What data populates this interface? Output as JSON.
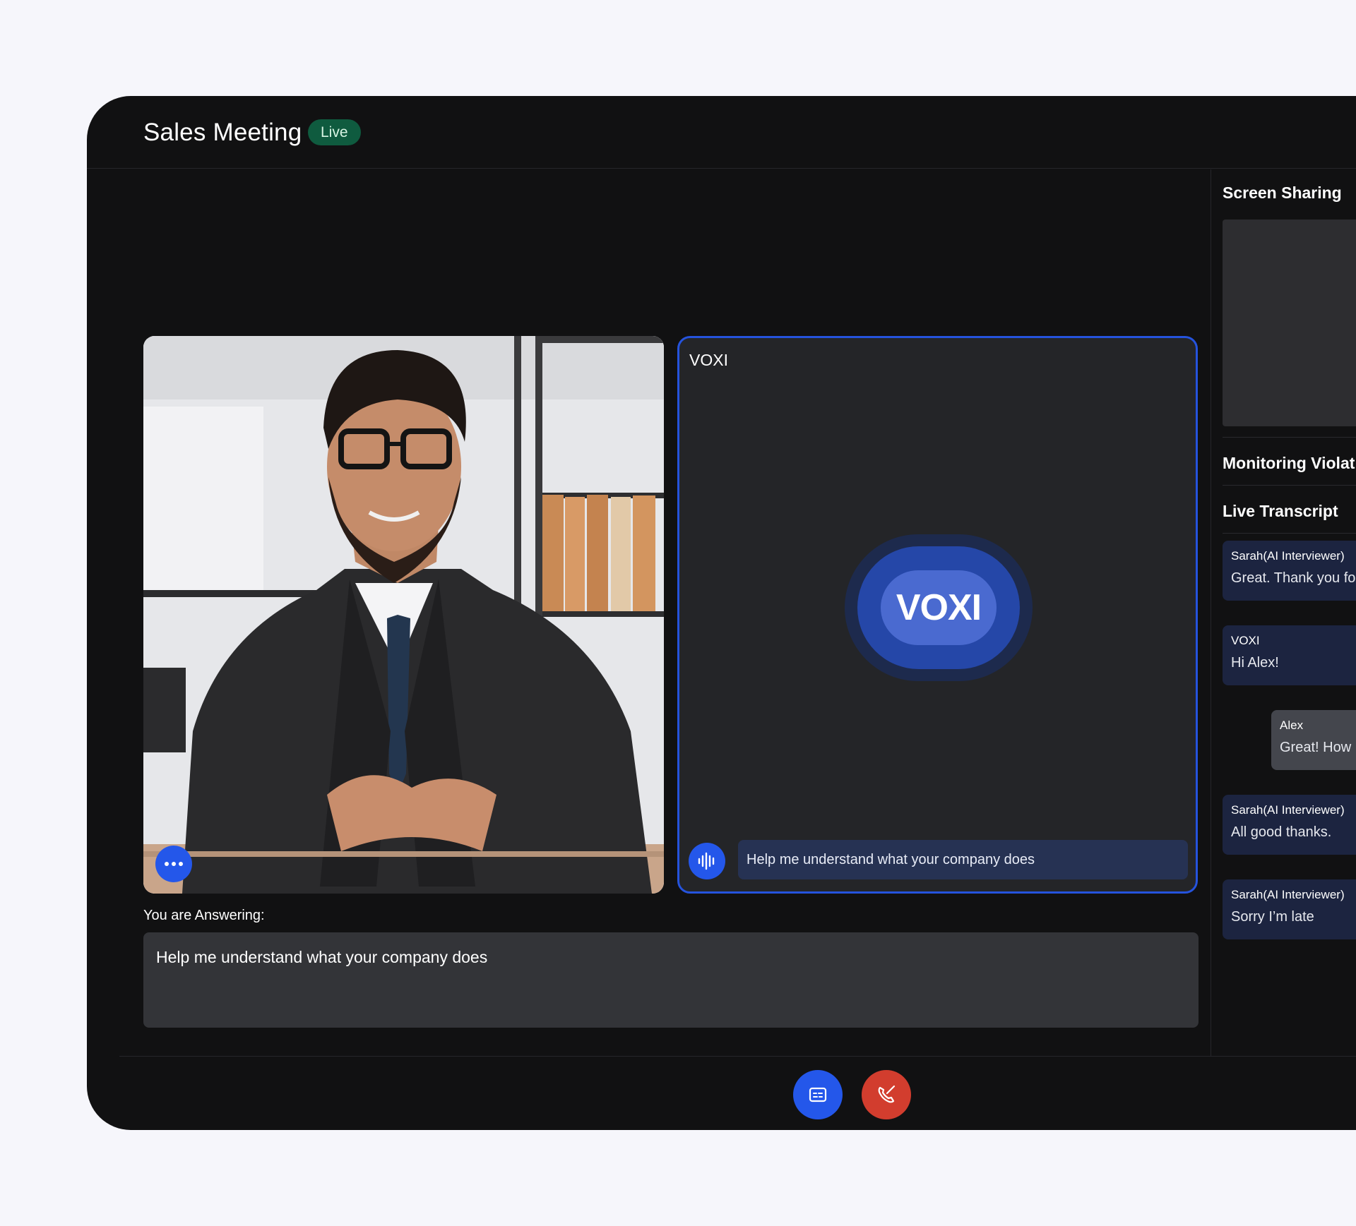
{
  "meeting": {
    "title": "Sales Meeting",
    "status": "Live"
  },
  "participant": {
    "photo_alt": "participant video"
  },
  "ai_tile": {
    "name": "VOXI",
    "avatar_text": "VOXI",
    "caption": "Help me understand what your company does"
  },
  "answer": {
    "label": "You are Answering:",
    "text": "Help me understand what your company does"
  },
  "sidebar": {
    "screen_sharing": "Screen Sharing",
    "monitoring": "Monitoring Violat",
    "transcript_heading": "Live Transcript",
    "messages": [
      {
        "sender": "Sarah(AI Interviewer)",
        "text": "Great. Thank you fo"
      },
      {
        "sender": "VOXI",
        "text": "Hi Alex!"
      },
      {
        "sender": "Alex",
        "text": "Great! How"
      },
      {
        "sender": "Sarah(AI Interviewer)",
        "text": "All good thanks."
      },
      {
        "sender": "Sarah(AI Interviewer)",
        "text": "Sorry I’m late"
      }
    ]
  },
  "colors": {
    "accent": "#2457ea",
    "live_badge": "#0f5b3f",
    "end_call": "#d23d2e",
    "window_bg": "#111112"
  },
  "icons": {
    "more": "ellipsis-icon",
    "speaking": "sound-wave-icon",
    "captions": "captions-icon",
    "end_call": "phone-hangup-icon"
  }
}
